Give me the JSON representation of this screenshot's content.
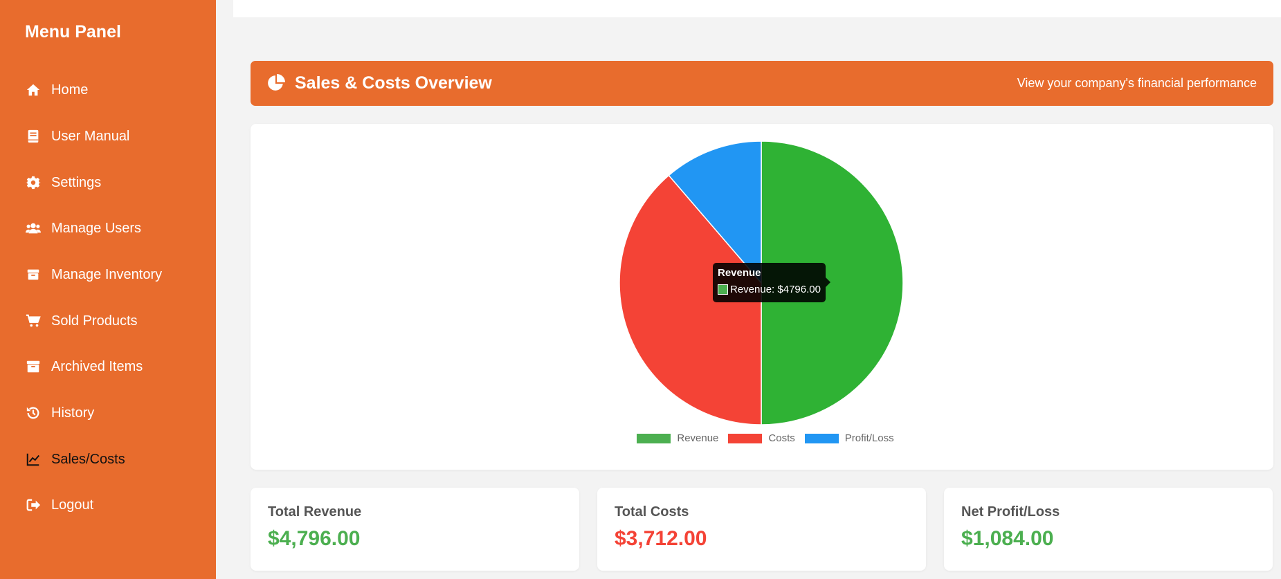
{
  "sidebar": {
    "title": "Menu Panel",
    "items": [
      {
        "label": "Home",
        "icon": "home-icon"
      },
      {
        "label": "User Manual",
        "icon": "book-icon"
      },
      {
        "label": "Settings",
        "icon": "gear-icon"
      },
      {
        "label": "Manage Users",
        "icon": "users-icon"
      },
      {
        "label": "Manage Inventory",
        "icon": "box-icon"
      },
      {
        "label": "Sold Products",
        "icon": "cart-icon"
      },
      {
        "label": "Archived Items",
        "icon": "archive-icon"
      },
      {
        "label": "History",
        "icon": "history-icon"
      },
      {
        "label": "Sales/Costs",
        "icon": "chart-line-icon",
        "active": true
      },
      {
        "label": "Logout",
        "icon": "logout-icon"
      }
    ]
  },
  "banner": {
    "title": "Sales & Costs Overview",
    "subtitle": "View your company's financial performance",
    "icon": "pie-chart-icon"
  },
  "tooltip": {
    "title": "Revenue",
    "text": "Revenue: $4796.00"
  },
  "stats": [
    {
      "label": "Total Revenue",
      "value": "$4,796.00",
      "color": "#4caf50"
    },
    {
      "label": "Total Costs",
      "value": "$3,712.00",
      "color": "#f44336"
    },
    {
      "label": "Net Profit/Loss",
      "value": "$1,084.00",
      "color": "#4caf50"
    }
  ],
  "colors": {
    "accent": "#e86c2d",
    "revenue": "#2fb234",
    "costs": "#f44336",
    "profit": "#2196f3"
  },
  "chart_data": {
    "type": "pie",
    "categories": [
      "Revenue",
      "Costs",
      "Profit/Loss"
    ],
    "values": [
      4796,
      3712,
      1084
    ],
    "colors": [
      "#2fb234",
      "#f44336",
      "#2196f3"
    ],
    "legend_colors": [
      "#4caf50",
      "#f44336",
      "#2196f3"
    ],
    "legend": "bottom"
  }
}
